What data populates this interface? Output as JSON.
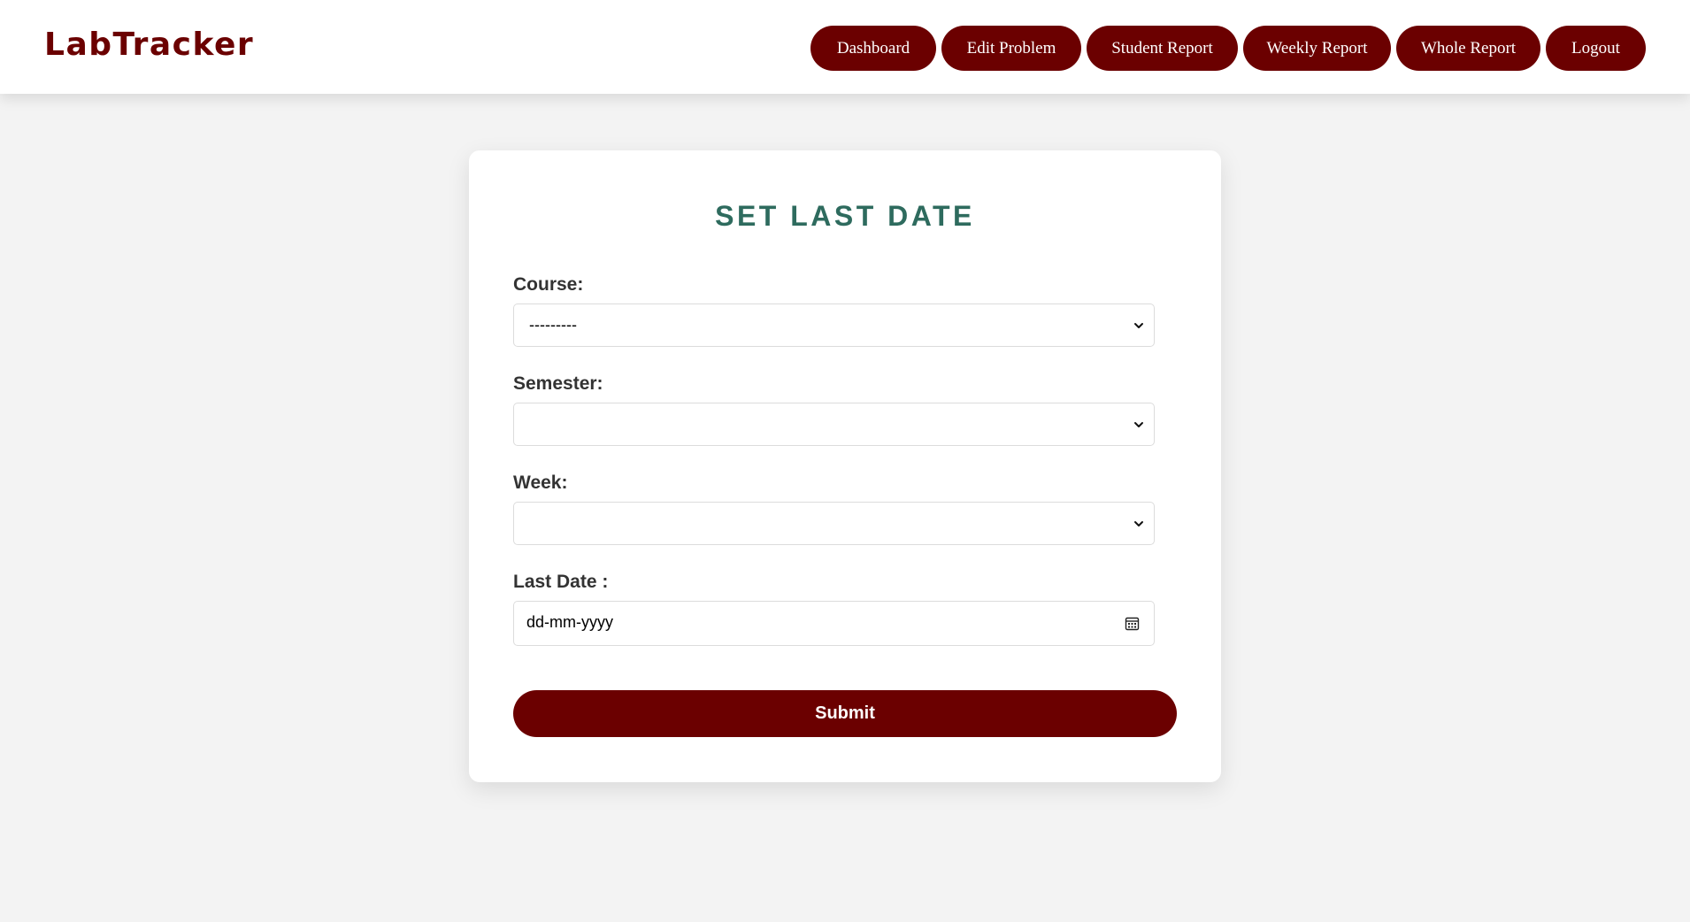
{
  "brand": {
    "name": "LabTracker"
  },
  "nav": {
    "items": [
      {
        "label": "Dashboard"
      },
      {
        "label": "Edit Problem"
      },
      {
        "label": "Student Report"
      },
      {
        "label": "Weekly Report"
      },
      {
        "label": "Whole Report"
      },
      {
        "label": "Logout"
      }
    ]
  },
  "form": {
    "title": "SET LAST DATE",
    "course": {
      "label": "Course:",
      "value": "---------"
    },
    "semester": {
      "label": "Semester:",
      "value": ""
    },
    "week": {
      "label": "Week:",
      "value": ""
    },
    "last_date": {
      "label": "Last Date :",
      "placeholder": "dd-mm-yyyy"
    },
    "submit_label": "Submit"
  },
  "colors": {
    "accent": "#6b0000",
    "title": "#2e6b5e",
    "background": "#f3f3f3"
  },
  "icons": {
    "select": "chevron-down-icon",
    "date": "calendar-icon"
  }
}
